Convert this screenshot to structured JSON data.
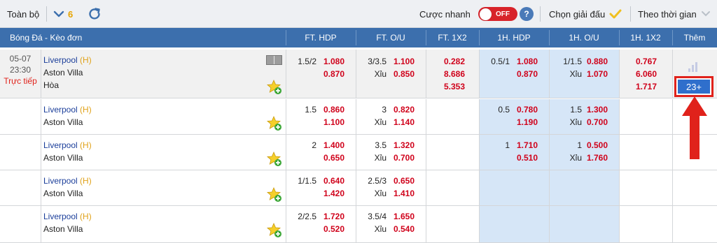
{
  "toolbar": {
    "scope_label": "Toàn bộ",
    "count": "6",
    "quick_bet_label": "Cược nhanh",
    "toggle_state": "OFF",
    "help_label": "?",
    "league_label": "Chọn giải đấu",
    "time_label": "Theo thời gian"
  },
  "header": {
    "league": "Bóng Đá - Kèo đơn",
    "ft_hdp": "FT. HDP",
    "ft_ou": "FT. O/U",
    "ft_1x2": "FT. 1X2",
    "h1_hdp": "1H. HDP",
    "h1_ou": "1H. O/U",
    "h1_1x2": "1H. 1X2",
    "more": "Thêm"
  },
  "match": {
    "date": "05-07",
    "time": "23:30",
    "live": "Trực tiếp",
    "home": "Liverpool",
    "home_tag": "(H)",
    "away": "Aston Villa",
    "draw": "Hòa",
    "more_count": "23+"
  },
  "rows": [
    {
      "ft_hdp": {
        "line": "1.5/2",
        "home": "1.080",
        "away": "0.870"
      },
      "ft_ou": {
        "line": "3/3.5",
        "over": "1.100",
        "under_label": "Xỉu",
        "under": "0.850"
      },
      "ft_1x2": [
        "0.282",
        "8.686",
        "5.353"
      ],
      "h1_hdp": {
        "line": "0.5/1",
        "home": "1.080",
        "away": "0.870"
      },
      "h1_ou": {
        "line": "1/1.5",
        "over": "0.880",
        "under_label": "Xỉu",
        "under": "1.070"
      },
      "h1_1x2": [
        "0.767",
        "6.060",
        "1.717"
      ]
    },
    {
      "ft_hdp": {
        "line": "1.5",
        "home": "0.860",
        "away": "1.100"
      },
      "ft_ou": {
        "line": "3",
        "over": "0.820",
        "under_label": "Xỉu",
        "under": "1.140"
      },
      "h1_hdp": {
        "line": "0.5",
        "home": "0.780",
        "away": "1.190"
      },
      "h1_ou": {
        "line": "1.5",
        "over": "1.300",
        "under_label": "Xỉu",
        "under": "0.700"
      }
    },
    {
      "ft_hdp": {
        "line": "2",
        "home": "1.400",
        "away": "0.650"
      },
      "ft_ou": {
        "line": "3.5",
        "over": "1.320",
        "under_label": "Xỉu",
        "under": "0.700"
      },
      "h1_hdp": {
        "line": "1",
        "home": "1.710",
        "away": "0.510"
      },
      "h1_ou": {
        "line": "1",
        "over": "0.500",
        "under_label": "Xỉu",
        "under": "1.760"
      }
    },
    {
      "ft_hdp": {
        "line": "1/1.5",
        "home": "0.640",
        "away": "1.420"
      },
      "ft_ou": {
        "line": "2.5/3",
        "over": "0.650",
        "under_label": "Xỉu",
        "under": "1.410"
      }
    },
    {
      "ft_hdp": {
        "line": "2/2.5",
        "home": "1.720",
        "away": "0.520"
      },
      "ft_ou": {
        "line": "3.5/4",
        "over": "1.650",
        "under_label": "Xỉu",
        "under": "0.540"
      }
    }
  ],
  "colors": {
    "header_blue": "#3c6fad",
    "odds_red": "#d0021b",
    "team_blue": "#1b3e9a",
    "home_tag": "#e0a21a",
    "cell_blue": "#d6e6f7",
    "toggle_red": "#d8232a",
    "highlight_red": "#e0221b"
  }
}
